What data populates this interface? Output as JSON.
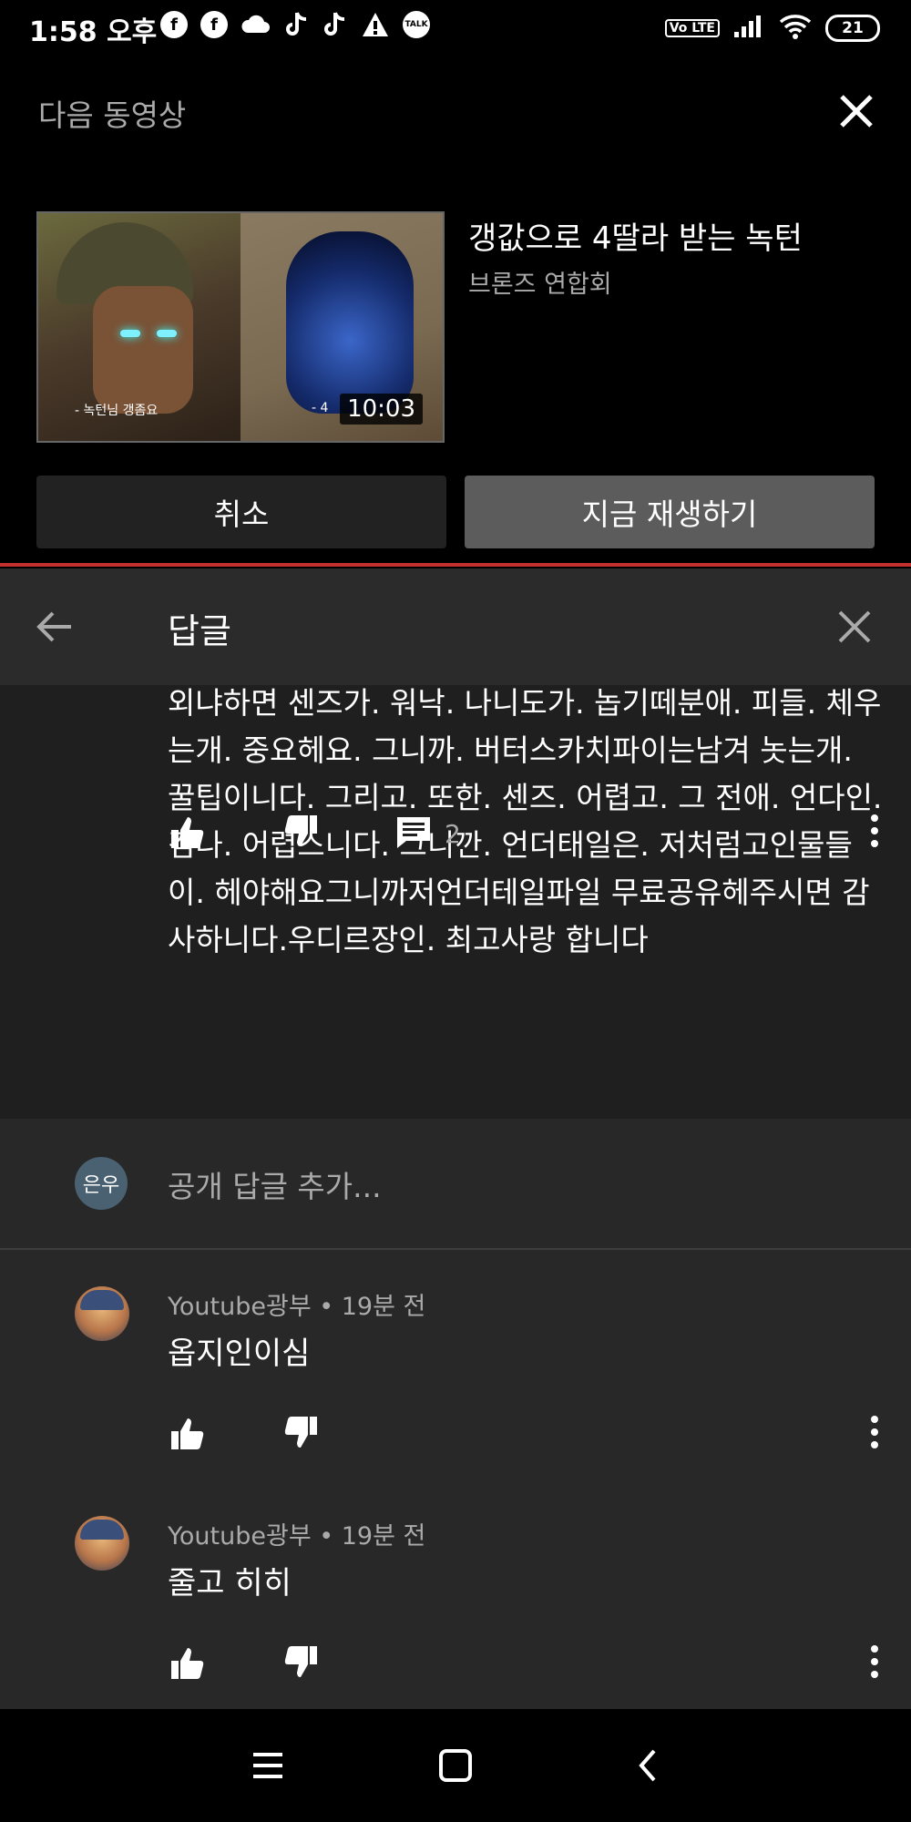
{
  "status_bar": {
    "time": "1:58 오후",
    "left_icons": [
      "facebook-icon",
      "facebook-icon",
      "cloud-icon",
      "tiktok-icon",
      "tiktok-icon",
      "warning-icon",
      "kakaotalk-icon"
    ],
    "talk_label": "TALK",
    "volte_label": "Vo LTE",
    "battery": "21"
  },
  "up_next": {
    "title": "다음 동영상",
    "video": {
      "title": "갱값으로 4딸라 받는 녹턴",
      "channel": "브론즈 연합회",
      "duration": "10:03",
      "thumb_caption_left": "- 녹턴님 갱좀요",
      "thumb_caption_right": "- 4"
    },
    "cancel_label": "취소",
    "play_label": "지금 재생하기"
  },
  "replies": {
    "title": "답글",
    "main_comment": {
      "text": "외냐하면 센즈가. 워낙. 나니도가. 놉기떼분애. 피들. 체우는개. 중요헤요. 그니까. 버터스카치파이는남겨 놋는개. 꿀팁이니다. 그리고. 또한. 센즈. 어렵고. 그 전애. 언다인. 검나. 어렵스니다. 그니깐. 언더태일은. 저처럼고인물들이. 헤야해요그니까저언더테일파일 무료공유헤주시면 감사하니다.우디르장인. 최고사랑 합니다",
      "reply_count": "2"
    },
    "add_reply": {
      "avatar_text": "은우",
      "placeholder": "공개 답글 추가..."
    },
    "items": [
      {
        "meta": "Youtube광부 • 19분 전",
        "text": "옵지인이심"
      },
      {
        "meta": "Youtube광부 • 19분 전",
        "text": "줄고 히히"
      }
    ]
  }
}
